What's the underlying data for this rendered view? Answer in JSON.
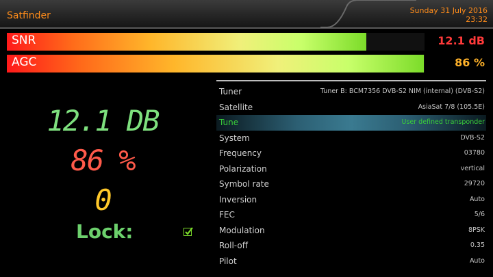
{
  "header": {
    "title": "Satfinder",
    "date": "Sunday 31 July 2016",
    "time": "23:32"
  },
  "bars": {
    "snr": {
      "label": "SNR",
      "value": "12.1 dB",
      "fill": 0.86
    },
    "agc": {
      "label": "AGC",
      "value": "86 %",
      "fill": 0.998
    }
  },
  "readouts": {
    "snr": "12.1 DB",
    "agc": "86 %",
    "ber": "0",
    "lock_label": "Lock:"
  },
  "info": [
    {
      "key": "Tuner",
      "value": "Tuner B: BCM7356 DVB-S2 NIM (internal) (DVB-S2)"
    },
    {
      "key": "Satellite",
      "value": "AsiaSat 7/8 (105.5E)"
    },
    {
      "key": "Tune",
      "value": "User defined transponder",
      "selected": true
    },
    {
      "key": "System",
      "value": "DVB-S2"
    },
    {
      "key": "Frequency",
      "value": "03780"
    },
    {
      "key": "Polarization",
      "value": "vertical"
    },
    {
      "key": "Symbol rate",
      "value": "29720"
    },
    {
      "key": "Inversion",
      "value": "Auto"
    },
    {
      "key": "FEC",
      "value": "5/6"
    },
    {
      "key": "Modulation",
      "value": "8PSK"
    },
    {
      "key": "Roll-off",
      "value": "0.35"
    },
    {
      "key": "Pilot",
      "value": "Auto"
    }
  ],
  "colors": {
    "accent": "#ff8c1a",
    "selected_text": "#3ad03a"
  }
}
